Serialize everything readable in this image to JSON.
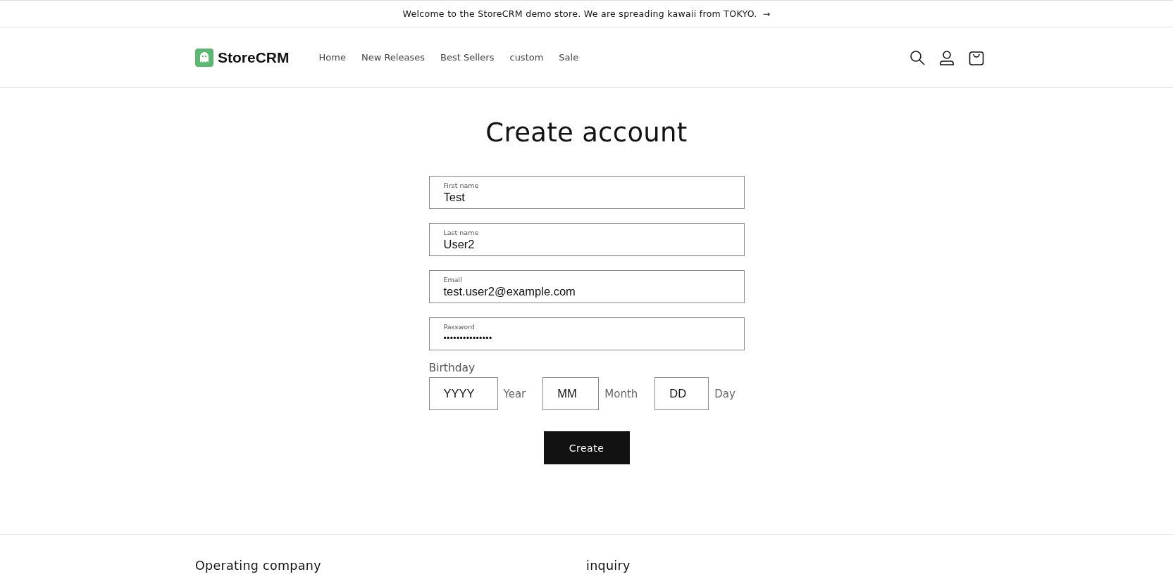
{
  "announcement": {
    "text": "Welcome to the StoreCRM demo store. We are spreading kawaii from TOKYO.",
    "arrow": "→"
  },
  "header": {
    "logo": "StoreCRM",
    "nav": [
      {
        "label": "Home"
      },
      {
        "label": "New Releases"
      },
      {
        "label": "Best Sellers"
      },
      {
        "label": "custom"
      },
      {
        "label": "Sale"
      }
    ]
  },
  "page": {
    "title": "Create account",
    "fields": [
      {
        "label": "First name",
        "value": "Test"
      },
      {
        "label": "Last name",
        "value": "User2"
      },
      {
        "label": "Email",
        "value": "test.user2@example.com"
      },
      {
        "label": "Password",
        "value": "•••••••••••••••"
      }
    ],
    "birthday": {
      "label": "Birthday",
      "parts": [
        {
          "placeholder": "YYYY",
          "unit": "Year"
        },
        {
          "placeholder": "MM",
          "unit": "Month"
        },
        {
          "placeholder": "DD",
          "unit": "Day"
        }
      ]
    },
    "submit": "Create"
  },
  "footer": {
    "headings": [
      "Operating company",
      "inquiry"
    ]
  }
}
